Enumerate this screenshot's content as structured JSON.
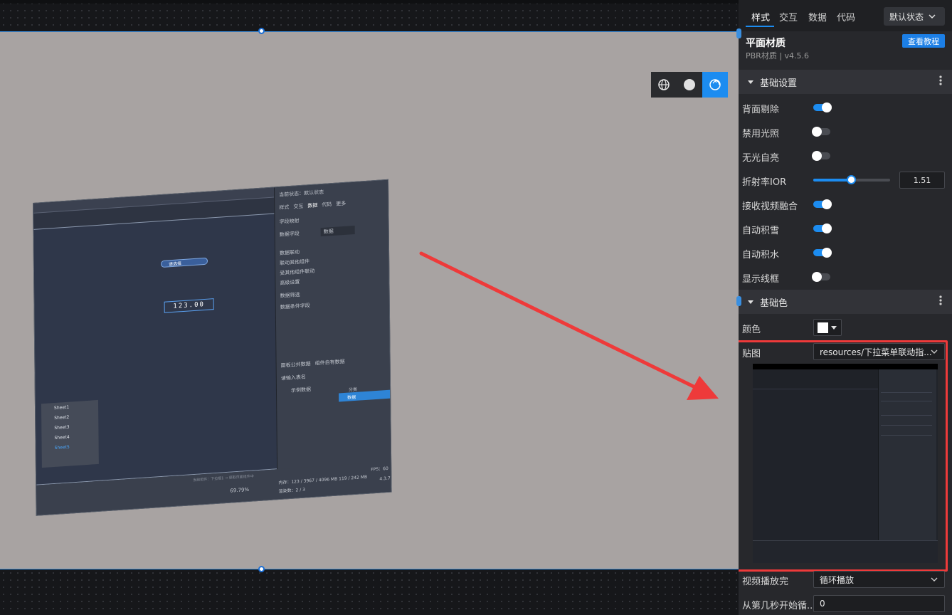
{
  "view_modes": [
    {
      "name": "wireframe-sphere",
      "active": false
    },
    {
      "name": "solid-sphere",
      "active": false
    },
    {
      "name": "rotate-view",
      "active": true
    }
  ],
  "embedded_shot": {
    "state_label": "当前状态：默认状态",
    "tabs": [
      "样式",
      "交互",
      "数据",
      "代码",
      "更多"
    ],
    "section_field": "字段映射",
    "field_label": "数据字段",
    "field_value": "数据",
    "section_link": "数据联动",
    "link_a": "联动其他组件",
    "link_b": "受其他组件联动",
    "link_c": "高级设置",
    "sub_a": "数据筛选",
    "sub_b": "数据条件字段",
    "data_tabs": [
      "面板公共数据",
      "组件自有数据"
    ],
    "search_placeholder": "请输入表名",
    "sheet_group": "示例数据",
    "sheets": [
      "Sheet1",
      "Sheet2",
      "Sheet3",
      "Sheet4",
      "Sheet5"
    ],
    "col_a": "分类",
    "col_b": "数据",
    "pill_label": "请选择",
    "number_display": "123.00",
    "zoom": "69.79%",
    "memory": "内存：123 / 3967 / 4096 MB  119 / 242 MB",
    "fps": "FPS：60",
    "drawcalls": "渲染数：2 / 3",
    "version": "4.3.7",
    "hint": "当前组件：下拉框1 → 获取页面组件中"
  },
  "panel": {
    "tabs": [
      "样式",
      "交互",
      "数据",
      "代码"
    ],
    "state_select": "默认状态",
    "component_name": "平面材质",
    "component_version": "PBR材质 | v4.5.6",
    "tutorial_button": "查看教程",
    "section_basic": "基础设置",
    "props": [
      {
        "label": "背面剔除",
        "on": true
      },
      {
        "label": "禁用光照",
        "on": false
      },
      {
        "label": "无光自亮",
        "on": false
      }
    ],
    "ior_label": "折射率IOR",
    "ior_value": "1.51",
    "ior_fraction": 0.49,
    "props2": [
      {
        "label": "接收视频融合",
        "on": true
      },
      {
        "label": "自动积雪",
        "on": true
      },
      {
        "label": "自动积水",
        "on": true
      },
      {
        "label": "显示线框",
        "on": false
      }
    ],
    "section_color": "基础色",
    "color_label": "颜色",
    "color_value": "#ffffff",
    "texture_label": "贴图",
    "texture_value": "resources/下拉菜单联动指...",
    "video_end_label": "视频播放完",
    "video_end_value": "循环播放",
    "loop_from_label": "从第几秒开始循...",
    "loop_from_value": "0"
  },
  "colors": {
    "accent": "#1c8cf0",
    "highlight": "#ee3a3a",
    "viewport": "#a8a3a2"
  }
}
